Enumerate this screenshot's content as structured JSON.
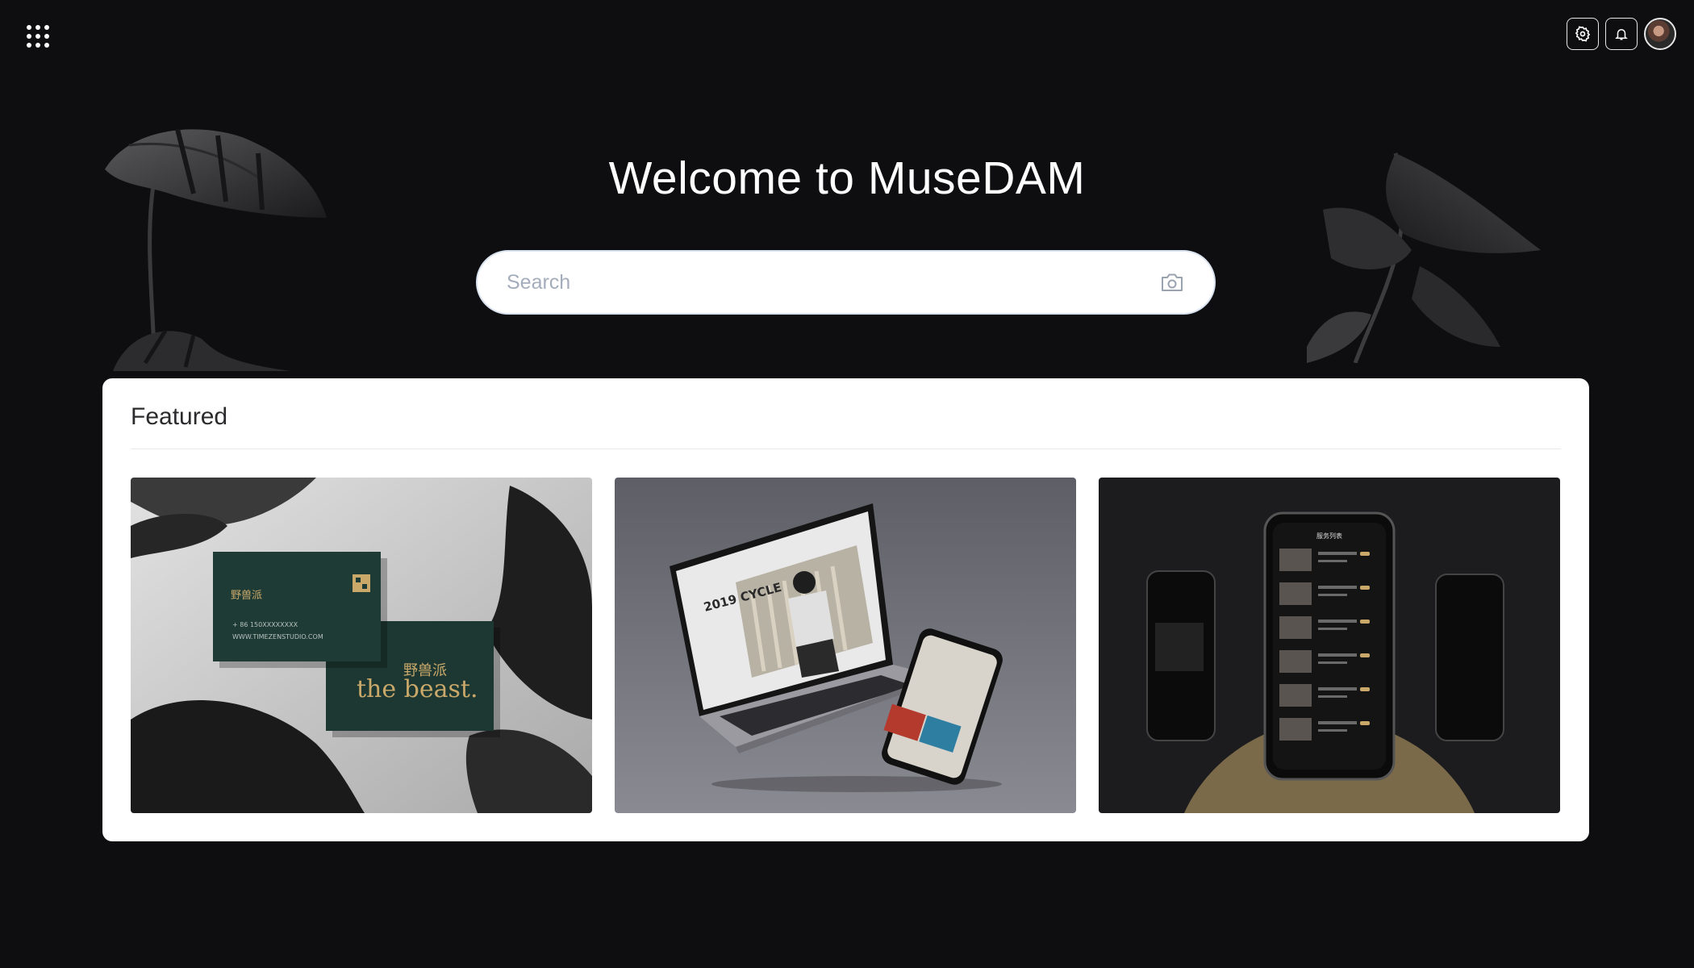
{
  "topbar": {
    "apps_icon": "apps-grid-icon",
    "settings_icon": "gear-icon",
    "notifications_icon": "bell-icon",
    "avatar": "user-avatar"
  },
  "hero": {
    "title": "Welcome to MuseDAM",
    "search": {
      "placeholder": "Search",
      "value": "",
      "camera_icon": "camera-icon"
    }
  },
  "featured": {
    "title": "Featured",
    "cards": [
      {
        "name": "business-card-mockup",
        "card_front_logo": "野兽派",
        "card_front_phone": "+ 86 150XXXXXXXX",
        "card_front_site": "WWW.TIMEZENSTUDIO.COM",
        "card_back_logo": "野兽派",
        "card_back_tagline": "the beast."
      },
      {
        "name": "laptop-phone-mockup",
        "screen_text": "2019 CYCLE"
      },
      {
        "name": "mobile-app-mockup",
        "screen_title": "服务列表"
      }
    ]
  },
  "colors": {
    "background": "#0e0e10",
    "card": "#ffffff",
    "gold": "#c9a86a",
    "dark_green": "#1d3832"
  }
}
